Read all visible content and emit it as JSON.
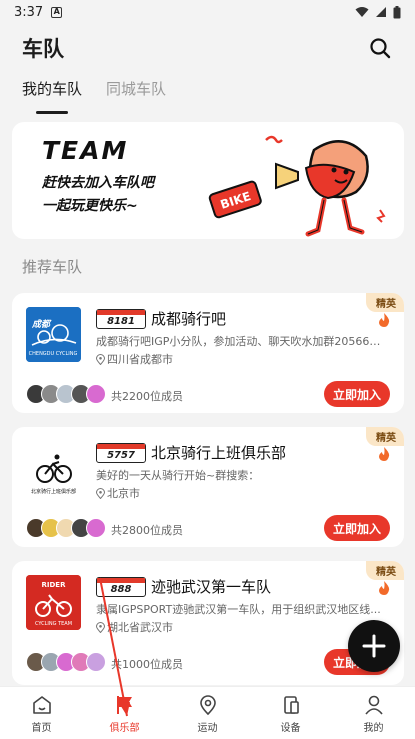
{
  "status_bar": {
    "time": "3:37",
    "notification_icon": "A"
  },
  "header": {
    "title": "车队"
  },
  "tabs": [
    {
      "label": "我的车队",
      "active": true
    },
    {
      "label": "同城车队",
      "active": false
    }
  ],
  "banner": {
    "title": "TEAM",
    "line1": "赶快去加入车队吧",
    "line2": "一起玩更快乐~",
    "bike_sign": "BIKE"
  },
  "section_title": "推荐车队",
  "teams": [
    {
      "plate": "8181",
      "name": "成都骑行吧",
      "description": "成都骑行吧IGP小分队，参加活动、聊天吹水加群2056696...",
      "location": "四川省成都市",
      "badge": "精英",
      "members": "共2200位成员",
      "join_label": "立即加入",
      "logo_text": "成都骑行吧"
    },
    {
      "plate": "5757",
      "name": "北京骑行上班俱乐部",
      "description": "美好的一天从骑行开始~群搜索：",
      "location": "北京市",
      "badge": "精英",
      "members": "共2800位成员",
      "join_label": "立即加入",
      "logo_text": "北京骑行上班俱乐部"
    },
    {
      "plate": "888",
      "name": "迹驰武汉第一车队",
      "description": "隶属IGPSPORT迹驰武汉第一车队，用于组织武汉地区线...",
      "location": "湖北省武汉市",
      "badge": "精英",
      "members": "共1000位成员",
      "join_label": "立即加入",
      "logo_text": "RIDER CYCLING TEAM"
    }
  ],
  "bottom_nav": [
    {
      "label": "首页",
      "icon": "home-icon",
      "active": false
    },
    {
      "label": "俱乐部",
      "icon": "flag-icon",
      "active": true
    },
    {
      "label": "运动",
      "icon": "location-pin-icon",
      "active": false
    },
    {
      "label": "设备",
      "icon": "device-icon",
      "active": false
    },
    {
      "label": "我的",
      "icon": "profile-icon",
      "active": false
    }
  ],
  "colors": {
    "accent": "#e8372a",
    "badge_bg": "#fbe6c7",
    "background": "#f3f3f3"
  }
}
